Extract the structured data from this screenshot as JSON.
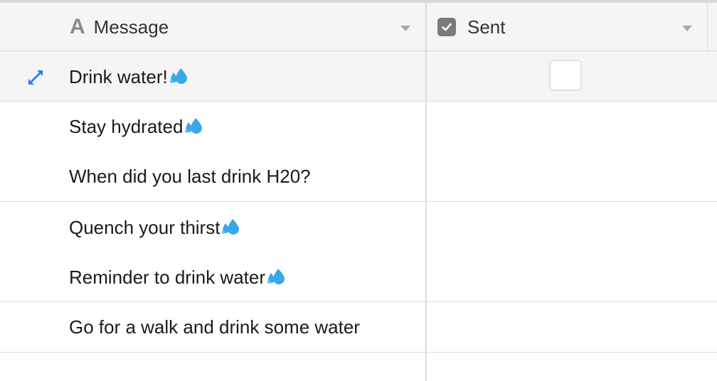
{
  "columns": {
    "message": {
      "label": "Message",
      "icon": "text-field-icon"
    },
    "sent": {
      "label": "Sent",
      "icon": "checkbox-field-icon"
    }
  },
  "rows": [
    {
      "message": "Drink water!",
      "emoji": "sweat-droplets",
      "sent": false
    },
    {
      "message": "Stay hydrated",
      "emoji": "sweat-droplets",
      "sent": false
    },
    {
      "message": "When did you last drink H20?",
      "emoji": "",
      "sent": false
    },
    {
      "message": "Quench your thirst",
      "emoji": "sweat-droplets",
      "sent": false
    },
    {
      "message": "Reminder to drink water",
      "emoji": "sweat-droplets",
      "sent": false
    },
    {
      "message": "Go for a walk and drink some water",
      "emoji": "",
      "sent": false
    }
  ],
  "colors": {
    "header_bg": "#f5f5f5",
    "active_row_bg": "#f5f5f5",
    "expand_icon": "#2d7ff9",
    "droplet": "#3aa7e8",
    "border": "#dedede"
  }
}
